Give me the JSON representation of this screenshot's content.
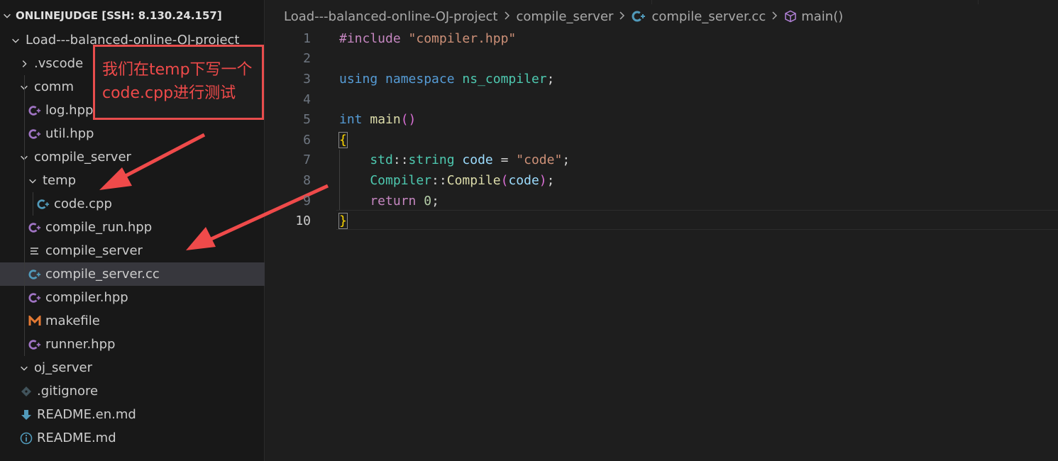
{
  "explorer": {
    "root_label": "ONLINEJUDGE [SSH: 8.130.24.157]",
    "items": [
      {
        "label": "Load---balanced-online-OJ-project",
        "kind": "folder-open"
      },
      {
        "label": ".vscode",
        "kind": "folder-closed"
      },
      {
        "label": "comm",
        "kind": "folder-open"
      },
      {
        "label": "log.hpp",
        "kind": "cpp-header"
      },
      {
        "label": "util.hpp",
        "kind": "cpp-header"
      },
      {
        "label": "compile_server",
        "kind": "folder-open"
      },
      {
        "label": "temp",
        "kind": "folder-open"
      },
      {
        "label": "code.cpp",
        "kind": "cpp-source"
      },
      {
        "label": "compile_run.hpp",
        "kind": "cpp-header"
      },
      {
        "label": "compile_server",
        "kind": "binary"
      },
      {
        "label": "compile_server.cc",
        "kind": "cpp-source",
        "selected": true
      },
      {
        "label": "compiler.hpp",
        "kind": "cpp-header"
      },
      {
        "label": "makefile",
        "kind": "makefile"
      },
      {
        "label": "runner.hpp",
        "kind": "cpp-header"
      },
      {
        "label": "oj_server",
        "kind": "folder-open"
      },
      {
        "label": ".gitignore",
        "kind": "git"
      },
      {
        "label": "README.en.md",
        "kind": "markdown-download"
      },
      {
        "label": "README.md",
        "kind": "info"
      }
    ]
  },
  "annotation": {
    "line1": "我们在temp下写一个",
    "line2": "code.cpp进行测试",
    "color": "#e84d4d"
  },
  "breadcrumb": {
    "project": "Load---balanced-online-OJ-project",
    "folder": "compile_server",
    "file": "compile_server.cc",
    "symbol": "main()"
  },
  "editor": {
    "active_line": 10,
    "line_numbers": [
      "1",
      "2",
      "3",
      "4",
      "5",
      "6",
      "7",
      "8",
      "9",
      "10"
    ],
    "lines": [
      [
        {
          "t": "#include ",
          "c": "pp"
        },
        {
          "t": "\"compiler.hpp\"",
          "c": "str"
        }
      ],
      [],
      [
        {
          "t": "using ",
          "c": "kw"
        },
        {
          "t": "namespace ",
          "c": "kw"
        },
        {
          "t": "ns_compiler",
          "c": "ns"
        },
        {
          "t": ";",
          "c": "op"
        }
      ],
      [],
      [
        {
          "t": "int ",
          "c": "kw"
        },
        {
          "t": "main",
          "c": "fn"
        },
        {
          "t": "()",
          "c": "br2"
        }
      ],
      [
        {
          "t": "{",
          "c": "br"
        }
      ],
      [
        {
          "t": "    std",
          "c": "ns"
        },
        {
          "t": "::",
          "c": "op"
        },
        {
          "t": "string ",
          "c": "ns"
        },
        {
          "t": "code",
          "c": "var"
        },
        {
          "t": " = ",
          "c": "op"
        },
        {
          "t": "\"code\"",
          "c": "str"
        },
        {
          "t": ";",
          "c": "op"
        }
      ],
      [
        {
          "t": "    Compiler",
          "c": "ns"
        },
        {
          "t": "::",
          "c": "op"
        },
        {
          "t": "Compile",
          "c": "fn"
        },
        {
          "t": "(",
          "c": "br2"
        },
        {
          "t": "code",
          "c": "var"
        },
        {
          "t": ")",
          "c": "br2"
        },
        {
          "t": ";",
          "c": "op"
        }
      ],
      [
        {
          "t": "    return ",
          "c": "ctl"
        },
        {
          "t": "0",
          "c": "num"
        },
        {
          "t": ";",
          "c": "op"
        }
      ],
      [
        {
          "t": "}",
          "c": "br"
        }
      ]
    ]
  },
  "colors": {
    "sidebar_bg": "#181818",
    "editor_bg": "#1e1e1e",
    "selection_bg": "#37373d",
    "annotation_red": "#e84d4d"
  }
}
